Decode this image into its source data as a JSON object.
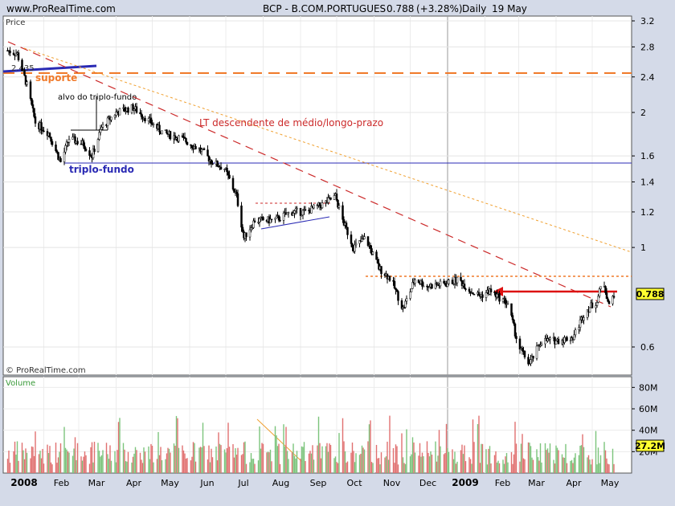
{
  "header": {
    "site": "www.ProRealTime.com",
    "symbol": "BCP - B.COM.PORTUGUES",
    "last": "0.788",
    "change": "(+3.28%)",
    "period": "Daily",
    "date": "19 May"
  },
  "price_panel": {
    "label": "Price",
    "watermark": "© ProRealTime.com",
    "last_badge": "0.788"
  },
  "volume_panel": {
    "label": "Volume",
    "last_badge": "27.2M"
  },
  "annotations": {
    "resistance_value": "2.435",
    "suporte": "suporte",
    "alvo": "alvo do triplo-fundo",
    "triplo": "triplo-fundo",
    "lt": "LT descendente de médio/longo-prazo"
  },
  "colors": {
    "background": "#ffffff",
    "frame": "#d4dae8",
    "orange": "#f07a2a",
    "red_trend": "#cc2a2a",
    "blue": "#2a2ab4",
    "volume": "#7cc47c",
    "volume_red": "#e07070"
  },
  "chart_data": {
    "type": "candlestick",
    "title": "BCP - B.COM.PORTUGUES",
    "y_scale": "log",
    "ylim": [
      0.5,
      3.25
    ],
    "y_ticks": [
      0.6,
      1,
      1.2,
      1.4,
      1.6,
      2,
      2.4,
      2.8,
      3.2
    ],
    "y_tick_labels": [
      "0.6",
      "1",
      "1.2",
      "1.4",
      "1.6",
      "2",
      "2.4",
      "2.8",
      "3.2"
    ],
    "x_labels": [
      "2008",
      "Feb",
      "Mar",
      "Apr",
      "May",
      "Jun",
      "Jul",
      "Aug",
      "Sep",
      "Oct",
      "Nov",
      "Dec",
      "2009",
      "Feb",
      "Mar",
      "Apr",
      "May"
    ],
    "last_close": 0.788,
    "close_path": [
      [
        "2008-01-02",
        2.75
      ],
      [
        "2008-01-10",
        2.7
      ],
      [
        "2008-01-18",
        2.3
      ],
      [
        "2008-01-25",
        1.9
      ],
      [
        "2008-02-05",
        1.8
      ],
      [
        "2008-02-15",
        1.55
      ],
      [
        "2008-02-22",
        1.75
      ],
      [
        "2008-03-05",
        1.7
      ],
      [
        "2008-03-12",
        1.6
      ],
      [
        "2008-03-20",
        1.85
      ],
      [
        "2008-04-01",
        2.0
      ],
      [
        "2008-04-15",
        2.05
      ],
      [
        "2008-04-25",
        1.95
      ],
      [
        "2008-05-10",
        1.8
      ],
      [
        "2008-05-25",
        1.75
      ],
      [
        "2008-06-10",
        1.65
      ],
      [
        "2008-06-20",
        1.55
      ],
      [
        "2008-06-30",
        1.5
      ],
      [
        "2008-07-10",
        1.3
      ],
      [
        "2008-07-16",
        1.05
      ],
      [
        "2008-07-25",
        1.15
      ],
      [
        "2008-08-10",
        1.15
      ],
      [
        "2008-08-25",
        1.2
      ],
      [
        "2008-09-05",
        1.2
      ],
      [
        "2008-09-20",
        1.25
      ],
      [
        "2008-09-30",
        1.3
      ],
      [
        "2008-10-06",
        1.15
      ],
      [
        "2008-10-15",
        1.0
      ],
      [
        "2008-10-25",
        1.05
      ],
      [
        "2008-11-05",
        0.9
      ],
      [
        "2008-11-15",
        0.85
      ],
      [
        "2008-11-25",
        0.73
      ],
      [
        "2008-12-05",
        0.85
      ],
      [
        "2008-12-15",
        0.82
      ],
      [
        "2008-12-31",
        0.83
      ],
      [
        "2009-01-10",
        0.85
      ],
      [
        "2009-01-20",
        0.8
      ],
      [
        "2009-01-28",
        0.78
      ],
      [
        "2009-02-05",
        0.8
      ],
      [
        "2009-02-20",
        0.75
      ],
      [
        "2009-03-01",
        0.6
      ],
      [
        "2009-03-10",
        0.55
      ],
      [
        "2009-03-20",
        0.62
      ],
      [
        "2009-04-01",
        0.62
      ],
      [
        "2009-04-15",
        0.63
      ],
      [
        "2009-04-25",
        0.72
      ],
      [
        "2009-05-05",
        0.76
      ],
      [
        "2009-05-10",
        0.85
      ],
      [
        "2009-05-15",
        0.74
      ],
      [
        "2009-05-19",
        0.788
      ]
    ],
    "volume_axis": {
      "ticks": [
        20,
        40,
        60,
        80
      ],
      "tick_labels": [
        "20M",
        "40M",
        "60M",
        "80M"
      ],
      "max": 90,
      "last": 27.2
    }
  }
}
